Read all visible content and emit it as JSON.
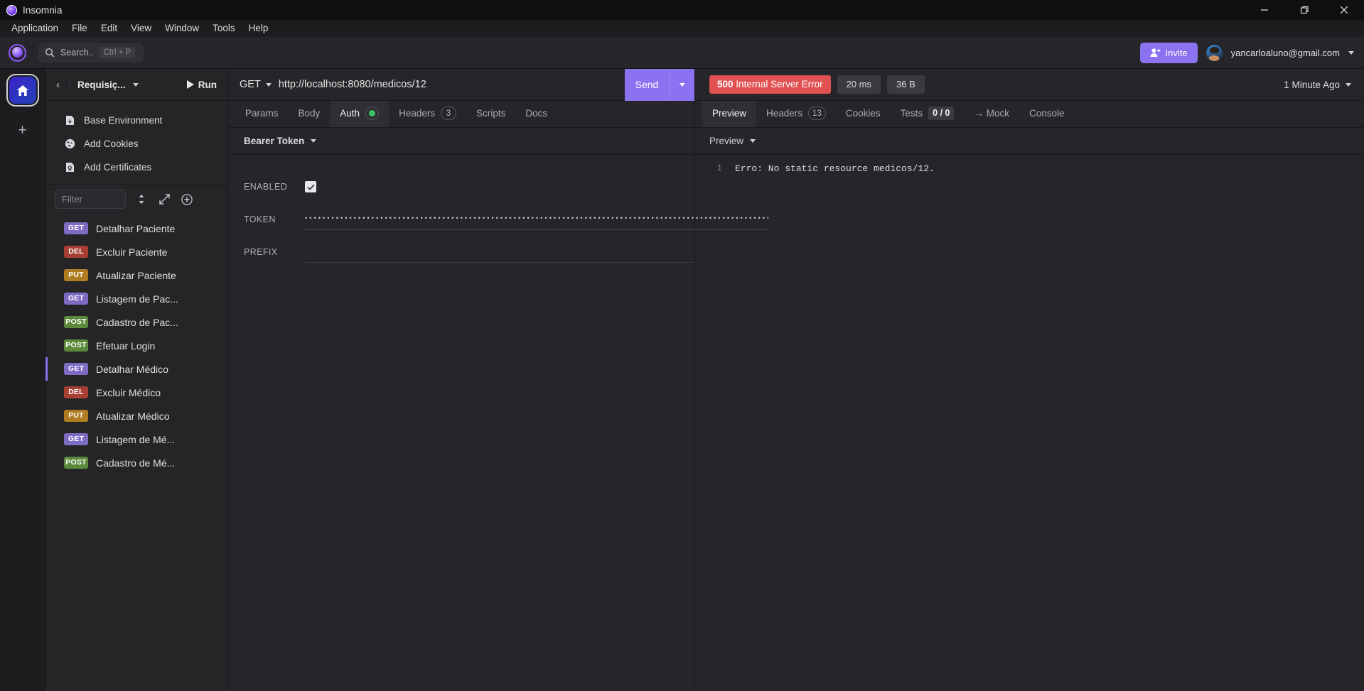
{
  "window": {
    "app_title": "Insomnia",
    "minimize_icon": "minimize-icon",
    "maximize_icon": "maximize-icon",
    "close_icon": "close-icon"
  },
  "menubar": {
    "items": [
      {
        "label": "Application"
      },
      {
        "label": "File"
      },
      {
        "label": "Edit"
      },
      {
        "label": "View"
      },
      {
        "label": "Window"
      },
      {
        "label": "Tools"
      },
      {
        "label": "Help"
      }
    ]
  },
  "toolbar": {
    "search_label": "Search..",
    "search_shortcut": "Ctrl + P",
    "invite_label": "Invite",
    "user_email": "yancarloaluno@gmail.com"
  },
  "rail": {
    "home_label": "home-icon",
    "add_label": "+"
  },
  "sidebar": {
    "back_label": "‹",
    "workspace_name": "Requisiç...",
    "run_label": "Run",
    "links": [
      {
        "label": "Base Environment",
        "icon": "environment-icon"
      },
      {
        "label": "Add Cookies",
        "icon": "cookie-icon"
      },
      {
        "label": "Add Certificates",
        "icon": "certificate-icon"
      }
    ],
    "filter_placeholder": "Filter",
    "filter_value": "",
    "sort_icon": "sort-icon",
    "expand_icon": "expand-icon",
    "add_icon": "plus-circle-icon",
    "requests": [
      {
        "method": "GET",
        "name": "Detalhar Paciente",
        "active": false
      },
      {
        "method": "DEL",
        "name": "Excluir Paciente",
        "active": false
      },
      {
        "method": "PUT",
        "name": "Atualizar Paciente",
        "active": false
      },
      {
        "method": "GET",
        "name": "Listagem de Pac...",
        "active": false
      },
      {
        "method": "POST",
        "name": "Cadastro de Pac...",
        "active": false
      },
      {
        "method": "POST",
        "name": "Efetuar Login",
        "active": false
      },
      {
        "method": "GET",
        "name": "Detalhar Médico",
        "active": true
      },
      {
        "method": "DEL",
        "name": "Excluir Médico",
        "active": false
      },
      {
        "method": "PUT",
        "name": "Atualizar Médico",
        "active": false
      },
      {
        "method": "GET",
        "name": "Listagem de Mé...",
        "active": false
      },
      {
        "method": "POST",
        "name": "Cadastro de Mé...",
        "active": false
      }
    ]
  },
  "request": {
    "method": "GET",
    "url": "http://localhost:8080/medicos/12",
    "send_label": "Send",
    "tabs": [
      {
        "label": "Params",
        "active": false,
        "badge": null,
        "badge_type": null
      },
      {
        "label": "Body",
        "active": false,
        "badge": null,
        "badge_type": null
      },
      {
        "label": "Auth",
        "active": true,
        "badge": "",
        "badge_type": "dot"
      },
      {
        "label": "Headers",
        "active": false,
        "badge": "3",
        "badge_type": "count"
      },
      {
        "label": "Scripts",
        "active": false,
        "badge": null,
        "badge_type": null
      },
      {
        "label": "Docs",
        "active": false,
        "badge": null,
        "badge_type": null
      }
    ],
    "auth": {
      "type": "Bearer Token",
      "enabled_label": "ENABLED",
      "enabled_checked": true,
      "token_label": "TOKEN",
      "token_masked": "••••••••••••••••••••••••••••••••••••••••••••••••••••••••••••••••••••••••••••••••••••••••••••••••••••••••••••••••••••••••••••••••••",
      "token_reveal_icon": "eye-icon",
      "prefix_label": "PREFIX",
      "prefix_value": ""
    }
  },
  "response": {
    "status_code": "500",
    "status_text": "Internal Server Error",
    "time": "20 ms",
    "size": "36 B",
    "timestamp": "1 Minute Ago",
    "tabs": [
      {
        "label": "Preview",
        "active": true,
        "badge": null,
        "badge_type": null
      },
      {
        "label": "Headers",
        "active": false,
        "badge": "13",
        "badge_type": "count"
      },
      {
        "label": "Cookies",
        "active": false,
        "badge": null,
        "badge_type": null
      },
      {
        "label": "Tests",
        "active": false,
        "badge": "0 / 0",
        "badge_type": "box"
      },
      {
        "label": "→ Mock",
        "active": false,
        "badge": null,
        "badge_type": null
      },
      {
        "label": "Console",
        "active": false,
        "badge": null,
        "badge_type": null
      }
    ],
    "preview_mode": "Preview",
    "body_lines": [
      {
        "number": "1",
        "text": "Erro: No static resource medicos/12."
      }
    ]
  },
  "colors": {
    "accent_purple": "#8b72f0",
    "error_red": "#e05252",
    "get_badge": "#7d6bc4",
    "del_badge": "#a83f34",
    "put_badge": "#b07c21",
    "post_badge": "#5c8a3c",
    "ok_green": "#3bbf63"
  }
}
